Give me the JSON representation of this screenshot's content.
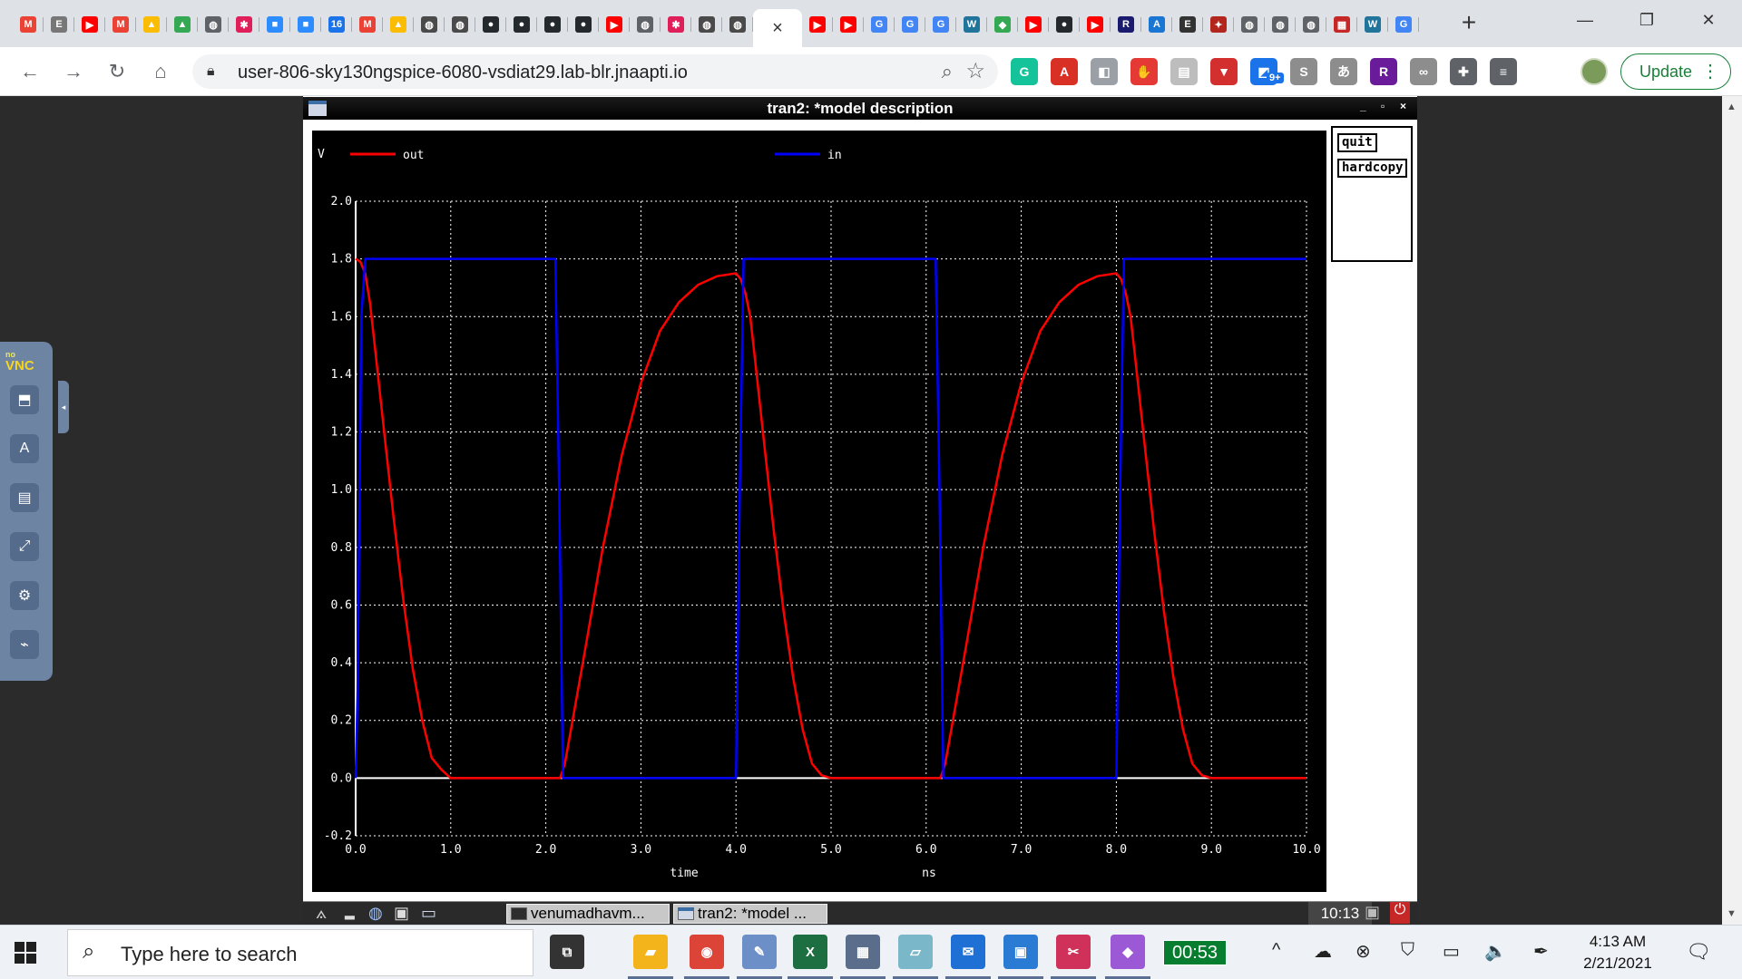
{
  "browser": {
    "tab_favicons": [
      {
        "name": "gmail-icon",
        "glyph": "M",
        "color": "#ea4335"
      },
      {
        "name": "e-icon",
        "glyph": "E",
        "color": "#777777"
      },
      {
        "name": "youtube-icon",
        "glyph": "▶",
        "color": "#ff0000"
      },
      {
        "name": "gmail-icon",
        "glyph": "M",
        "color": "#ea4335"
      },
      {
        "name": "drive-icon",
        "glyph": "▲",
        "color": "#fbbc04"
      },
      {
        "name": "drive-icon",
        "glyph": "▲",
        "color": "#34a853"
      },
      {
        "name": "globe-icon",
        "glyph": "◍",
        "color": "#5f6368"
      },
      {
        "name": "slack-icon",
        "glyph": "✱",
        "color": "#e01e5a"
      },
      {
        "name": "zoom-icon",
        "glyph": "■",
        "color": "#2d8cff"
      },
      {
        "name": "zoom-icon",
        "glyph": "■",
        "color": "#2d8cff"
      },
      {
        "name": "calendar-icon",
        "glyph": "16",
        "color": "#1a73e8"
      },
      {
        "name": "gmail-icon",
        "glyph": "M",
        "color": "#ea4335"
      },
      {
        "name": "drive-icon",
        "glyph": "▲",
        "color": "#fbbc04"
      },
      {
        "name": "globe-icon",
        "glyph": "◍",
        "color": "#4a4a4a"
      },
      {
        "name": "globe-icon",
        "glyph": "◍",
        "color": "#4a4a4a"
      },
      {
        "name": "github-icon",
        "glyph": "●",
        "color": "#24292e"
      },
      {
        "name": "github-icon",
        "glyph": "●",
        "color": "#24292e"
      },
      {
        "name": "github-icon",
        "glyph": "●",
        "color": "#24292e"
      },
      {
        "name": "github-icon",
        "glyph": "●",
        "color": "#24292e"
      },
      {
        "name": "youtube-icon",
        "glyph": "▶",
        "color": "#ff0000"
      },
      {
        "name": "globe-icon",
        "glyph": "◍",
        "color": "#5f6368"
      },
      {
        "name": "slack-icon",
        "glyph": "✱",
        "color": "#e01e5a"
      },
      {
        "name": "globe-icon",
        "glyph": "◍",
        "color": "#4a4a4a"
      },
      {
        "name": "globe-icon",
        "glyph": "◍",
        "color": "#4a4a4a"
      },
      {
        "name": "active-tab-close-icon",
        "glyph": "×",
        "color": "active"
      },
      {
        "name": "youtube-icon",
        "glyph": "▶",
        "color": "#ff0000"
      },
      {
        "name": "youtube-icon",
        "glyph": "▶",
        "color": "#ff0000"
      },
      {
        "name": "google-icon",
        "glyph": "G",
        "color": "#4285f4"
      },
      {
        "name": "google-icon",
        "glyph": "G",
        "color": "#4285f4"
      },
      {
        "name": "google-icon",
        "glyph": "G",
        "color": "#4285f4"
      },
      {
        "name": "wordpress-icon",
        "glyph": "W",
        "color": "#21759b"
      },
      {
        "name": "maps-icon",
        "glyph": "◆",
        "color": "#34a853"
      },
      {
        "name": "youtube-icon",
        "glyph": "▶",
        "color": "#ff0000"
      },
      {
        "name": "github-icon",
        "glyph": "●",
        "color": "#24292e"
      },
      {
        "name": "youtube-icon",
        "glyph": "▶",
        "color": "#ff0000"
      },
      {
        "name": "r-icon",
        "glyph": "R",
        "color": "#1a1a6e"
      },
      {
        "name": "a-icon",
        "glyph": "A",
        "color": "#1976d2"
      },
      {
        "name": "eav-icon",
        "glyph": "E",
        "color": "#333333"
      },
      {
        "name": "network-icon",
        "glyph": "✦",
        "color": "#b3261e"
      },
      {
        "name": "globe-icon",
        "glyph": "◍",
        "color": "#5f6368"
      },
      {
        "name": "globe-icon",
        "glyph": "◍",
        "color": "#5f6368"
      },
      {
        "name": "globe-icon",
        "glyph": "◍",
        "color": "#5f6368"
      },
      {
        "name": "app-icon",
        "glyph": "▦",
        "color": "#c62828"
      },
      {
        "name": "wordpress-icon",
        "glyph": "W",
        "color": "#21759b"
      },
      {
        "name": "google-icon",
        "glyph": "G",
        "color": "#4285f4"
      }
    ],
    "url": "user-806-sky130ngspice-6080-vsdiat29.lab-blr.jnaapti.io",
    "update_label": "Update",
    "extension_badge": "9+",
    "extensions": [
      {
        "name": "grammarly-icon",
        "glyph": "G",
        "color": "#15c39a"
      },
      {
        "name": "acrobat-icon",
        "glyph": "A",
        "color": "#d93025"
      },
      {
        "name": "extension-icon",
        "glyph": "◧",
        "color": "#9aa0a6"
      },
      {
        "name": "stop-icon",
        "glyph": "✋",
        "color": "#e53935"
      },
      {
        "name": "document-icon",
        "glyph": "▤",
        "color": "#bdbdbd"
      },
      {
        "name": "pocket-icon",
        "glyph": "▼",
        "color": "#d32f2f"
      },
      {
        "name": "tabs-icon",
        "glyph": "◩",
        "color": "#1a73e8"
      },
      {
        "name": "s-icon",
        "glyph": "S",
        "color": "#8d8d8d"
      },
      {
        "name": "translate-icon",
        "glyph": "あ",
        "color": "#8d8d8d"
      },
      {
        "name": "r-icon",
        "glyph": "R",
        "color": "#6a1b9a"
      },
      {
        "name": "link-icon",
        "glyph": "∞",
        "color": "#8d8d8d"
      },
      {
        "name": "puzzle-icon",
        "glyph": "✚",
        "color": "#5f6368"
      },
      {
        "name": "media-icon",
        "glyph": "≡",
        "color": "#5f6368"
      }
    ]
  },
  "novnc": {
    "logo_no": "no",
    "logo_vnc": "VNC",
    "buttons": [
      {
        "name": "display-icon",
        "glyph": "⬒"
      },
      {
        "name": "keyboard-icon",
        "glyph": "A"
      },
      {
        "name": "clipboard-icon",
        "glyph": "▤"
      },
      {
        "name": "fullscreen-icon",
        "glyph": "⤢"
      },
      {
        "name": "settings-icon",
        "glyph": "⚙"
      },
      {
        "name": "disconnect-icon",
        "glyph": "⌁"
      }
    ],
    "handle": "◂"
  },
  "plot_window": {
    "title": "tran2: *model description",
    "controls": [
      "_",
      "▫",
      "×"
    ],
    "quit_label": "quit",
    "hardcopy_label": "hardcopy"
  },
  "chart_data": {
    "type": "line",
    "title": "",
    "xlabel": "time",
    "xunit": "ns",
    "ylabel": "V",
    "xlim": [
      0,
      10
    ],
    "ylim": [
      -0.2,
      2.0
    ],
    "x_ticks": [
      "0.0",
      "1.0",
      "2.0",
      "3.0",
      "4.0",
      "5.0",
      "6.0",
      "7.0",
      "8.0",
      "9.0",
      "10.0"
    ],
    "y_ticks": [
      "-0.2",
      "0.0",
      "0.2",
      "0.4",
      "0.6",
      "0.8",
      "1.0",
      "1.2",
      "1.4",
      "1.6",
      "1.8",
      "2.0"
    ],
    "grid": true,
    "legend_position": "top",
    "background": "#000000",
    "series": [
      {
        "name": "out",
        "color": "#ff0000",
        "x": [
          0.0,
          0.05,
          0.1,
          0.15,
          0.2,
          0.3,
          0.4,
          0.5,
          0.6,
          0.7,
          0.8,
          0.9,
          1.0,
          1.5,
          2.0,
          2.1,
          2.15,
          2.2,
          2.4,
          2.6,
          2.8,
          3.0,
          3.2,
          3.4,
          3.6,
          3.8,
          4.0,
          4.05,
          4.1,
          4.15,
          4.2,
          4.3,
          4.4,
          4.5,
          4.6,
          4.7,
          4.8,
          4.9,
          5.0,
          5.5,
          6.0,
          6.1,
          6.15,
          6.2,
          6.4,
          6.6,
          6.8,
          7.0,
          7.2,
          7.4,
          7.6,
          7.8,
          8.0,
          8.05,
          8.1,
          8.15,
          8.2,
          8.3,
          8.4,
          8.5,
          8.6,
          8.7,
          8.8,
          8.9,
          9.0,
          9.5,
          10.0
        ],
        "y": [
          1.8,
          1.79,
          1.75,
          1.65,
          1.5,
          1.2,
          0.9,
          0.62,
          0.38,
          0.2,
          0.07,
          0.03,
          0.0,
          0.0,
          0.0,
          0.0,
          0.0,
          0.05,
          0.42,
          0.8,
          1.12,
          1.37,
          1.55,
          1.65,
          1.71,
          1.74,
          1.75,
          1.73,
          1.68,
          1.6,
          1.45,
          1.15,
          0.85,
          0.58,
          0.35,
          0.17,
          0.05,
          0.01,
          0.0,
          0.0,
          0.0,
          0.0,
          0.0,
          0.05,
          0.42,
          0.8,
          1.12,
          1.37,
          1.55,
          1.65,
          1.71,
          1.74,
          1.75,
          1.73,
          1.68,
          1.6,
          1.45,
          1.15,
          0.85,
          0.58,
          0.35,
          0.17,
          0.05,
          0.01,
          0.0,
          0.0,
          0.0
        ]
      },
      {
        "name": "in",
        "color": "#0000ff",
        "x": [
          0.0,
          0.02,
          0.06,
          0.1,
          2.1,
          2.14,
          2.18,
          4.0,
          4.04,
          4.08,
          6.1,
          6.14,
          6.18,
          8.0,
          8.04,
          8.08,
          10.0
        ],
        "y": [
          0.0,
          0.3,
          1.6,
          1.8,
          1.8,
          1.0,
          0.0,
          0.0,
          1.0,
          1.8,
          1.8,
          1.0,
          0.0,
          0.0,
          1.0,
          1.8,
          1.8
        ]
      }
    ]
  },
  "x_taskbar": {
    "windows": [
      "venumadhavm...",
      "tran2: *model ..."
    ],
    "clock": "10:13"
  },
  "taskbar": {
    "search_placeholder": "Type here to search",
    "timer": "00:53",
    "time": "4:13 AM",
    "date": "2/21/2021",
    "apps": [
      {
        "name": "task-view-icon",
        "glyph": "⧉",
        "color": "#333333"
      },
      {
        "name": "file-explorer-icon",
        "glyph": "▰",
        "color": "#f3b41b"
      },
      {
        "name": "chrome-icon",
        "glyph": "◉",
        "color": "#db4437"
      },
      {
        "name": "paint-icon",
        "glyph": "✎",
        "color": "#6d8fc7"
      },
      {
        "name": "excel-icon",
        "glyph": "X",
        "color": "#1d6f42"
      },
      {
        "name": "calculator-icon",
        "glyph": "▦",
        "color": "#5a6e8c"
      },
      {
        "name": "notepad-icon",
        "glyph": "▱",
        "color": "#7ab7c9"
      },
      {
        "name": "mail-icon",
        "glyph": "✉",
        "color": "#1e70d4"
      },
      {
        "name": "photos-icon",
        "glyph": "▣",
        "color": "#2a7bd4"
      },
      {
        "name": "snip-icon",
        "glyph": "✂",
        "color": "#d0315a"
      },
      {
        "name": "paint3d-icon",
        "glyph": "◆",
        "color": "#9b59d6"
      }
    ],
    "tray": [
      {
        "name": "chevron-up-icon",
        "glyph": "^"
      },
      {
        "name": "onedrive-icon",
        "glyph": "☁"
      },
      {
        "name": "sync-icon",
        "glyph": "⊗"
      },
      {
        "name": "security-icon",
        "glyph": "⛉"
      },
      {
        "name": "battery-icon",
        "glyph": "▭"
      },
      {
        "name": "volume-icon",
        "glyph": "🔈"
      },
      {
        "name": "pen-icon",
        "glyph": "✒"
      }
    ]
  }
}
